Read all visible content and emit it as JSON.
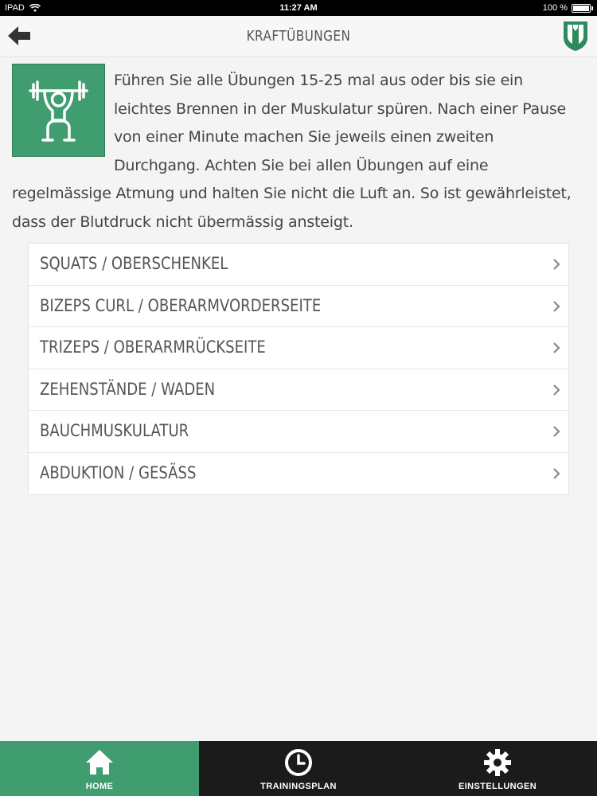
{
  "status_bar": {
    "device": "IPAD",
    "time": "11:27 AM",
    "battery_text": "100 %",
    "battery_level": 1.0
  },
  "nav": {
    "title": "KRAFTÜBUNGEN",
    "back_icon": "arrow-left-icon",
    "logo_icon": "app-logo-icon"
  },
  "intro": {
    "icon": "weightlifting-icon",
    "text": "Führen Sie alle Übungen 15-25 mal aus oder bis sie ein leichtes Brennen in der Muskulatur spüren. Nach einer Pause von einer Minute machen Sie jeweils einen zweiten Durchgang. Achten Sie bei allen Übungen auf eine regelmässige Atmung und halten Sie nicht die Luft an. So ist gewährleistet, dass der Blutdruck nicht übermässig ansteigt."
  },
  "exercises": [
    {
      "label": "SQUATS / OBERSCHENKEL"
    },
    {
      "label": "BIZEPS CURL / OBERARMVORDERSEITE"
    },
    {
      "label": "TRIZEPS / OBERARMRÜCKSEITE"
    },
    {
      "label": "ZEHENSTÄNDE / WADEN"
    },
    {
      "label": "BAUCHMUSKULATUR"
    },
    {
      "label": "ABDUKTION / GESÄSS"
    }
  ],
  "tabs": [
    {
      "label": "HOME",
      "icon": "home-icon",
      "active": true
    },
    {
      "label": "TRAININGSPLAN",
      "icon": "clock-icon",
      "active": false
    },
    {
      "label": "EINSTELLUNGEN",
      "icon": "gear-icon",
      "active": false
    }
  ],
  "colors": {
    "accent": "#3f9d70",
    "tabbar": "#1b1b1b",
    "background": "#f4f4f4"
  }
}
